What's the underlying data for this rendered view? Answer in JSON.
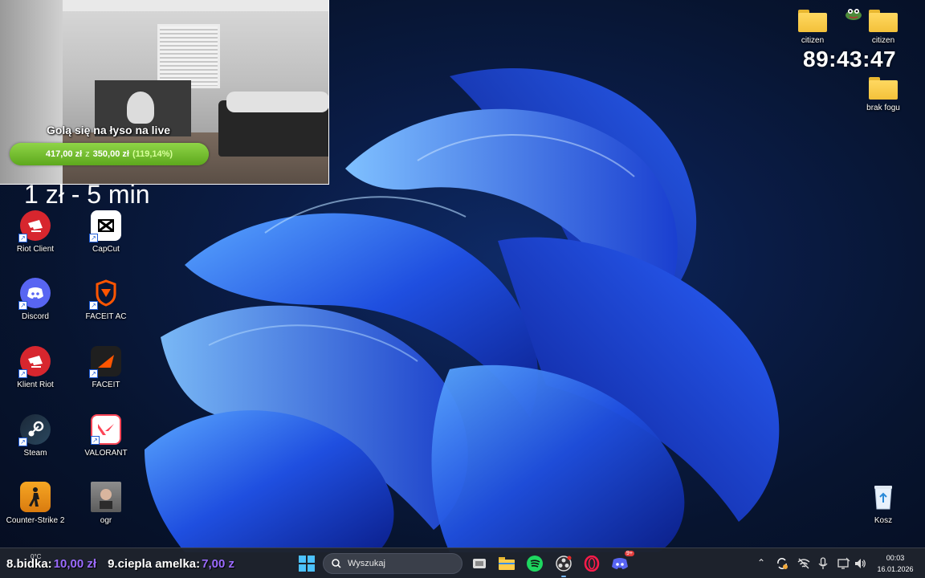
{
  "stream": {
    "goal_title": "Golą się na łyso na live",
    "goal_current": "417,00 zł",
    "goal_separator": "z",
    "goal_target": "350,00 zł",
    "goal_percent_label": "(119,14%)",
    "goal_progress": 1.0,
    "rate_text": "1 zł - 5 min",
    "timer": "89:43:47"
  },
  "desktop_icons_left": [
    {
      "label": "Riot Client",
      "icon": "riot-client-icon"
    },
    {
      "label": "CapCut",
      "icon": "capcut-icon"
    },
    {
      "label": "Discord",
      "icon": "discord-icon"
    },
    {
      "label": "FACEIT AC",
      "icon": "faceit-ac-icon"
    },
    {
      "label": "Klient Riot",
      "icon": "riot-client-icon"
    },
    {
      "label": "FACEIT",
      "icon": "faceit-icon"
    },
    {
      "label": "Steam",
      "icon": "steam-icon"
    },
    {
      "label": "VALORANT",
      "icon": "valorant-icon"
    },
    {
      "label": "Counter-Strike 2",
      "icon": "counter-strike-icon"
    },
    {
      "label": "ogr",
      "icon": "photo-icon"
    }
  ],
  "desktop_icons_right": [
    {
      "label": "citizen",
      "icon": "folder-icon"
    },
    {
      "label": "citizen",
      "icon": "folder-icon"
    },
    {
      "label": "brak fogu",
      "icon": "folder-icon"
    },
    {
      "label": "Kosz",
      "icon": "recycle-bin-icon"
    }
  ],
  "ticker": {
    "item1_label": "8.bidka:",
    "item1_amount": "10,00 zł",
    "item2_label": "9.ciepla amelka:",
    "item2_amount": "7,00 z"
  },
  "taskbar": {
    "weather": "0°C",
    "search_placeholder": "Wyszukaj",
    "time": "00:03",
    "date": "16.01.2026",
    "discord_badge": "9+"
  },
  "colors": {
    "goal_bar": "#6cb52a",
    "ticker_amount": "#9b6bff",
    "wallpaper_blue": "#1f4fe0"
  }
}
